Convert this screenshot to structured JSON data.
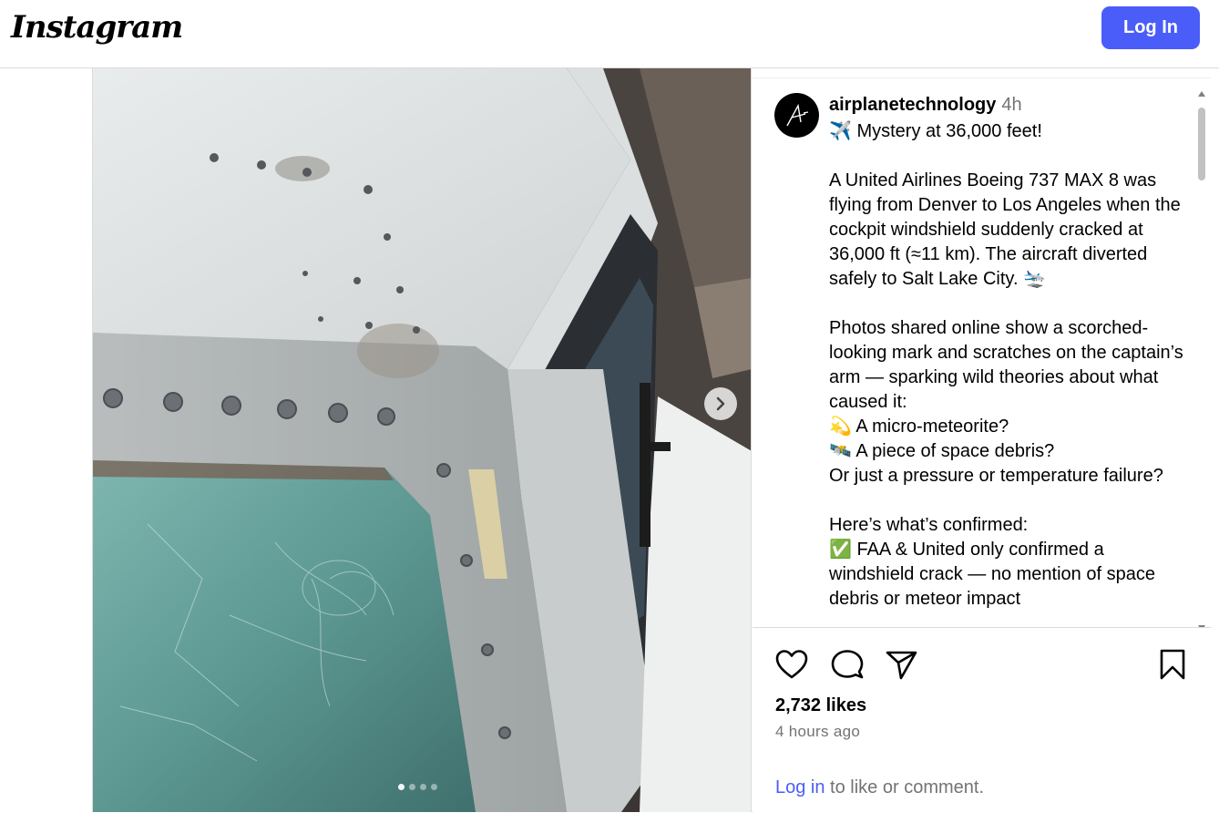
{
  "header": {
    "logo_text": "Instagram",
    "login_label": "Log In"
  },
  "post": {
    "username": "airplanetechnology",
    "time_ago": "4h",
    "caption": "✈️ Mystery at 36,000 feet!\n\nA United Airlines Boeing 737 MAX 8 was flying from Denver to Los Angeles when the cockpit windshield suddenly cracked at 36,000 ft (≈11 km). The aircraft diverted safely to Salt Lake City. 🛬\n\nPhotos shared online show a scorched-looking mark and scratches on the captain’s arm — sparking wild theories about what caused it:\n💫 A micro-meteorite?\n🛰️ A piece of space debris?\nOr just a pressure or temperature failure?\n\nHere’s what’s confirmed:\n✅ FAA & United only confirmed a windshield crack — no mention of space debris or meteor impact",
    "likes": "2,732 likes",
    "posted": "4 hours ago",
    "login_link": "Log in",
    "login_rest": " to like or comment.",
    "carousel_count": 4,
    "carousel_active": 0
  },
  "icons": {
    "like": "heart-icon",
    "comment": "comment-icon",
    "share": "share-icon",
    "save": "bookmark-icon",
    "next": "chevron-right-icon"
  },
  "colors": {
    "accent": "#4a5df9",
    "muted": "#737373"
  }
}
